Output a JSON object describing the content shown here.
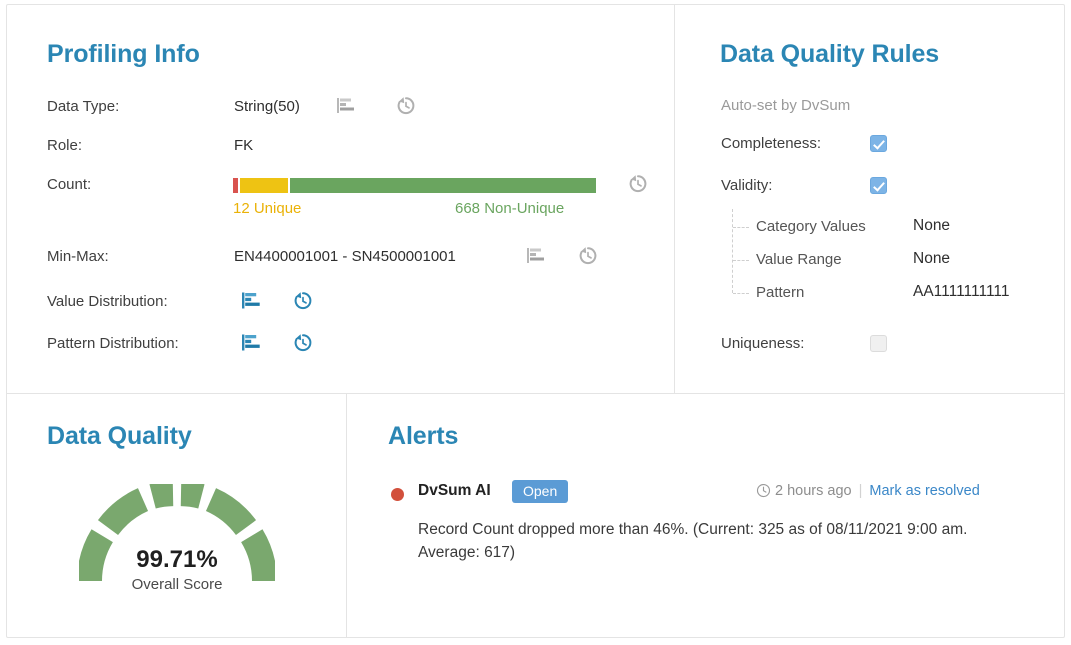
{
  "profiling": {
    "title": "Profiling Info",
    "rows": [
      {
        "label": "Data Type:",
        "value": "String(50)"
      },
      {
        "label": "Role:",
        "value": "FK"
      },
      {
        "label": "Count:",
        "value": ""
      },
      {
        "label": "Min-Max:",
        "value": "EN4400001001 - SN4500001001"
      },
      {
        "label": "Value Distribution:",
        "value": ""
      },
      {
        "label": "Pattern Distribution:",
        "value": ""
      }
    ],
    "count_bar": {
      "unique_label": "12 Unique",
      "non_unique_label": "668 Non-Unique",
      "unique_count": 12,
      "non_unique_count": 668,
      "segments": [
        {
          "name": "invalid",
          "color": "#d9534f",
          "percent": 1.5
        },
        {
          "name": "unique",
          "color": "#eec313",
          "percent": 13.5
        },
        {
          "name": "non-unique",
          "color": "#6aa55f",
          "percent": 85.0
        }
      ]
    },
    "icons": {
      "distribution": "bar-chart-icon",
      "history": "history-icon"
    }
  },
  "rules": {
    "title": "Data Quality Rules",
    "subtitle": "Auto-set by DvSum",
    "items": [
      {
        "label": "Completeness:",
        "checked": true
      },
      {
        "label": "Validity:",
        "checked": true
      },
      {
        "label": "Uniqueness:",
        "checked": false
      }
    ],
    "validity_details": [
      {
        "name": "Category Values",
        "value": "None"
      },
      {
        "name": "Value Range",
        "value": "None"
      },
      {
        "name": "Pattern",
        "value": "AA1111111111"
      }
    ]
  },
  "data_quality": {
    "title": "Data Quality",
    "score": "99.71%",
    "caption": "Overall Score",
    "score_value": 99.71,
    "gauge_color": "#7aa86e",
    "segments": 6
  },
  "alerts": {
    "title": "Alerts",
    "items": [
      {
        "source": "DvSum AI",
        "status": "Open",
        "time": "2 hours ago",
        "action": "Mark as resolved",
        "separator": "|",
        "description": "Record Count dropped more than 46%. (Current: 325 as of 08/11/2021 9:00 am. Average: 617)"
      }
    ]
  },
  "colors": {
    "heading": "#2b86b4",
    "green": "#6aa55f",
    "yellow": "#eab208",
    "red": "#d9534f",
    "badge_blue": "#5b9bd5",
    "link_blue": "#3a87c8",
    "icon_blue": "#2b86b4",
    "icon_gray": "#b0b0b0"
  }
}
